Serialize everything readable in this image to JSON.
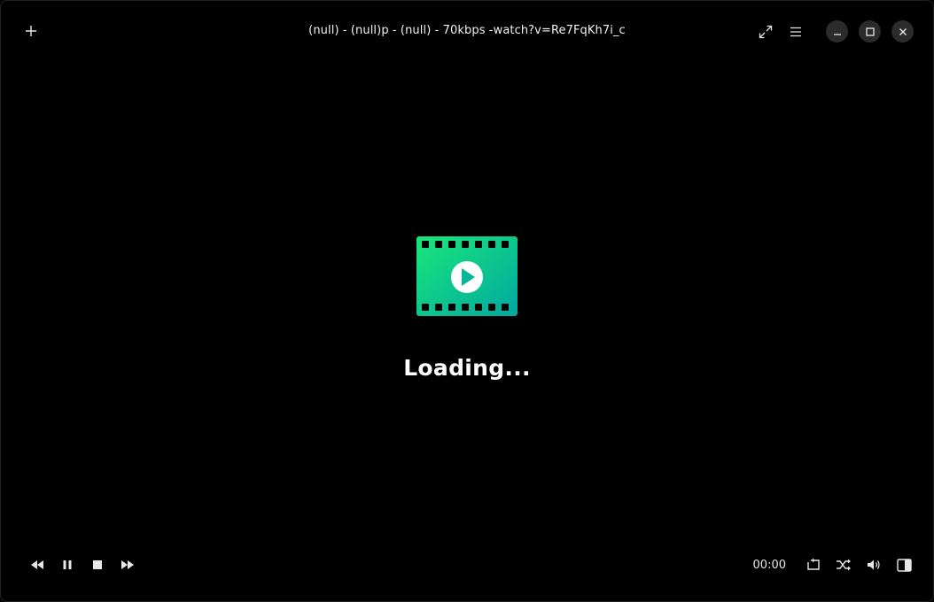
{
  "window": {
    "title": "(null) - (null)p - (null) - 70kbps -watch?v=Re7FqKh7i_c"
  },
  "titlebar_icons": [
    "plus-icon",
    "fullscreen-icon",
    "menu-icon",
    "minimize-icon",
    "maximize-icon",
    "close-icon"
  ],
  "center": {
    "logo_icon": "film-play-icon",
    "loading_text": "Loading..."
  },
  "controls": {
    "left": [
      "rewind-icon",
      "pause-icon",
      "stop-icon",
      "fast-forward-icon"
    ],
    "time": "00:00",
    "right": [
      "loop-icon",
      "shuffle-icon",
      "volume-icon",
      "playlist-panel-icon"
    ]
  },
  "colors": {
    "background": "#000000",
    "logo_gradient_start": "#19e77a",
    "logo_gradient_end": "#02a7a0",
    "text": "#ffffff"
  }
}
